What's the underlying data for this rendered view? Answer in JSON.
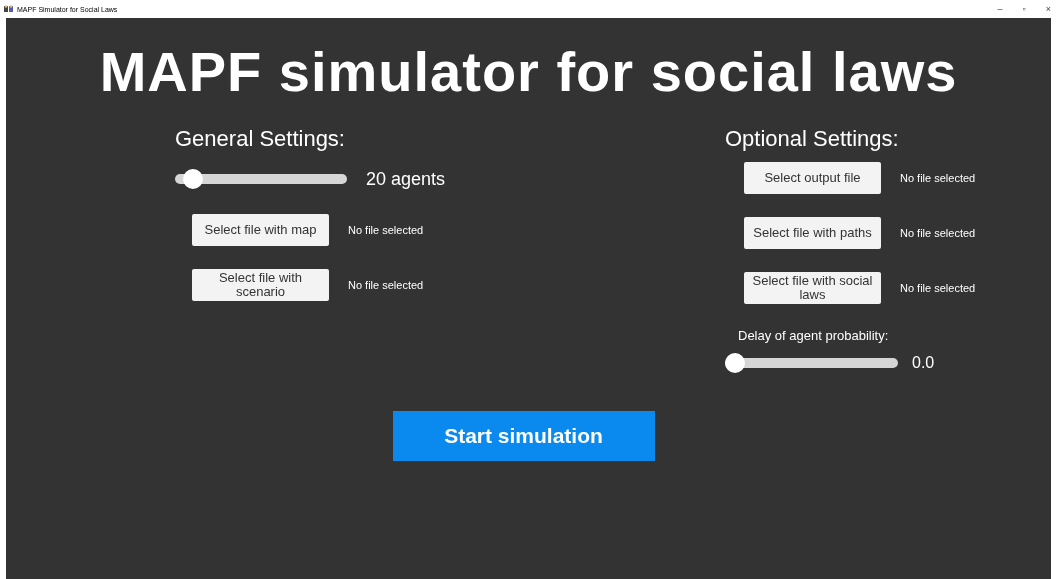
{
  "window": {
    "title": "MAPF Simulator for Social Laws",
    "controls": [
      "–",
      "▫",
      "×"
    ]
  },
  "heading": "MAPF simulator for social laws",
  "general": {
    "title": "General Settings:",
    "agents_slider": {
      "level": 0.05,
      "reading": "20 agents"
    },
    "files": [
      {
        "button": "Select file with map",
        "status": "No file selected"
      },
      {
        "button": "Select file with scenario",
        "status": "No file selected"
      }
    ]
  },
  "optional": {
    "title": "Optional Settings:",
    "files": [
      {
        "button": "Select output file",
        "status": "No file selected"
      },
      {
        "button": "Select file with paths",
        "status": "No file selected"
      },
      {
        "button": "Select file with social laws",
        "status": "No file selected"
      }
    ],
    "delay_label": "Delay of agent probability:",
    "delay_slider": {
      "level": 0,
      "reading": "0.0"
    }
  },
  "start_button": "Start simulation"
}
